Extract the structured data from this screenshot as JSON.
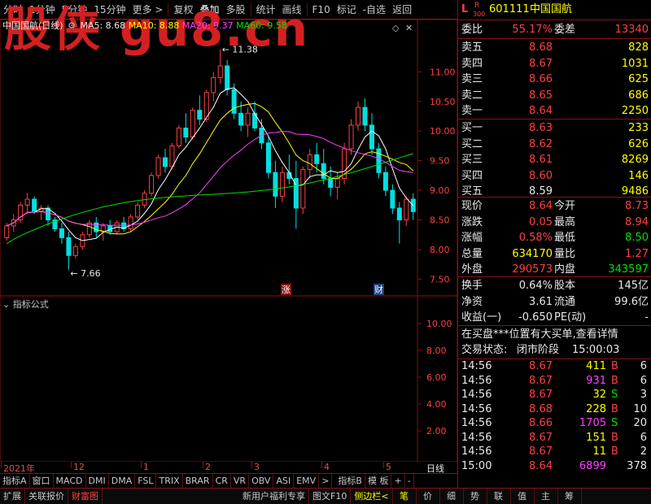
{
  "toolbar": {
    "items": [
      "分时",
      "1分钟",
      "5分钟",
      "15分钟",
      "更多 >",
      "复权",
      "叠加",
      "多股",
      "统计",
      "画线",
      "F10",
      "标记",
      "-自选",
      "返回"
    ]
  },
  "watermark": "股侠 gu8.cn",
  "legend": {
    "name": "中国国航(日线)",
    "ma5": "MA5: 8.68",
    "ma10": "MA10: 8.88",
    "ma20": "MA20: 9.37",
    "ma60": "MA60: 9.58"
  },
  "annotations": {
    "high": "11.38",
    "low": "7.66",
    "zhang": "涨",
    "cai": "财"
  },
  "indicator": {
    "title": "指标公式"
  },
  "colors": {
    "up": "#ff4040",
    "down": "#00e0e0",
    "ma5": "#ffffff",
    "ma10": "#ffff00",
    "ma20": "#ff40ff",
    "ma60": "#00e000",
    "grid": "#8a1010"
  },
  "chart_data": [
    {
      "type": "candlestick",
      "title": "中国国航(日线)",
      "ylim": [
        7.3,
        11.8
      ],
      "yticks": [
        "11.00",
        "10.50",
        "10.00",
        "9.50",
        "9.00",
        "8.50",
        "8.00",
        "7.50"
      ],
      "xticks": [
        "2021年",
        "12",
        "1",
        "2",
        "3",
        "4",
        "5"
      ],
      "series": [
        {
          "name": "MA5",
          "value": 8.68
        },
        {
          "name": "MA10",
          "value": 8.88
        },
        {
          "name": "MA20",
          "value": 9.37
        },
        {
          "name": "MA60",
          "value": 9.58
        }
      ],
      "ohlc": [
        [
          8.2,
          8.45,
          8.15,
          8.4
        ],
        [
          8.4,
          8.6,
          8.3,
          8.5
        ],
        [
          8.5,
          8.8,
          8.45,
          8.75
        ],
        [
          8.75,
          8.95,
          8.6,
          8.85
        ],
        [
          8.85,
          8.9,
          8.6,
          8.65
        ],
        [
          8.65,
          8.75,
          8.5,
          8.7
        ],
        [
          8.7,
          8.75,
          8.4,
          8.5
        ],
        [
          8.5,
          8.55,
          8.3,
          8.35
        ],
        [
          8.35,
          8.45,
          8.1,
          8.2
        ],
        [
          8.2,
          8.3,
          7.66,
          7.9
        ],
        [
          7.9,
          8.1,
          7.85,
          8.05
        ],
        [
          8.05,
          8.3,
          8.0,
          8.25
        ],
        [
          8.25,
          8.5,
          8.2,
          8.45
        ],
        [
          8.45,
          8.55,
          8.2,
          8.3
        ],
        [
          8.3,
          8.45,
          8.15,
          8.4
        ],
        [
          8.4,
          8.5,
          8.25,
          8.3
        ],
        [
          8.3,
          8.5,
          8.25,
          8.45
        ],
        [
          8.45,
          8.55,
          8.3,
          8.35
        ],
        [
          8.35,
          8.6,
          8.3,
          8.55
        ],
        [
          8.55,
          8.8,
          8.5,
          8.75
        ],
        [
          8.75,
          9.0,
          8.7,
          8.95
        ],
        [
          8.95,
          9.3,
          8.9,
          9.25
        ],
        [
          9.25,
          9.6,
          9.2,
          9.55
        ],
        [
          9.55,
          9.7,
          9.3,
          9.4
        ],
        [
          9.4,
          9.8,
          9.35,
          9.75
        ],
        [
          9.75,
          10.1,
          9.7,
          10.05
        ],
        [
          10.05,
          10.3,
          9.8,
          9.9
        ],
        [
          9.9,
          10.4,
          9.85,
          10.35
        ],
        [
          10.35,
          10.6,
          10.1,
          10.2
        ],
        [
          10.2,
          10.7,
          10.15,
          10.65
        ],
        [
          10.65,
          11.0,
          10.5,
          10.9
        ],
        [
          10.9,
          11.38,
          10.8,
          11.1
        ],
        [
          11.1,
          11.2,
          10.6,
          10.7
        ],
        [
          10.7,
          10.8,
          10.2,
          10.3
        ],
        [
          10.3,
          10.5,
          10.0,
          10.1
        ],
        [
          10.1,
          10.4,
          9.9,
          10.3
        ],
        [
          10.3,
          10.5,
          10.0,
          10.05
        ],
        [
          10.05,
          10.2,
          9.7,
          9.8
        ],
        [
          9.8,
          9.9,
          9.2,
          9.3
        ],
        [
          9.3,
          9.5,
          8.7,
          8.9
        ],
        [
          8.9,
          9.4,
          8.8,
          9.3
        ],
        [
          9.3,
          9.6,
          9.1,
          9.2
        ],
        [
          9.2,
          9.5,
          8.35,
          8.7
        ],
        [
          8.7,
          9.4,
          8.6,
          9.35
        ],
        [
          9.35,
          9.7,
          9.2,
          9.6
        ],
        [
          9.6,
          9.8,
          9.3,
          9.45
        ],
        [
          9.45,
          9.7,
          9.1,
          9.2
        ],
        [
          9.2,
          9.4,
          8.9,
          9.05
        ],
        [
          9.05,
          9.3,
          8.85,
          9.2
        ],
        [
          9.2,
          9.8,
          9.1,
          9.7
        ],
        [
          9.7,
          10.2,
          9.6,
          10.1
        ],
        [
          10.1,
          10.5,
          10.0,
          10.4
        ],
        [
          10.4,
          10.55,
          10.0,
          10.1
        ],
        [
          10.1,
          10.3,
          9.6,
          9.7
        ],
        [
          9.7,
          9.8,
          9.2,
          9.3
        ],
        [
          9.3,
          9.4,
          8.9,
          9.0
        ],
        [
          9.0,
          9.1,
          8.6,
          8.7
        ],
        [
          8.7,
          8.8,
          8.1,
          8.5
        ],
        [
          8.5,
          8.9,
          8.4,
          8.85
        ],
        [
          8.85,
          8.95,
          8.5,
          8.64
        ]
      ]
    },
    {
      "type": "line",
      "title": "指标公式",
      "yticks": [
        "10.00",
        "8.00",
        "6.00",
        "4.00",
        "2.00"
      ]
    }
  ],
  "timeaxis": [
    "2021年",
    "12",
    "1",
    "2",
    "3",
    "4",
    "5"
  ],
  "period": "日线",
  "indicatorTabs": [
    "指标A",
    "窗口",
    "MACD",
    "DMI",
    "DMA",
    "FSL",
    "TRIX",
    "BRAR",
    "CR",
    "VR",
    "OBV",
    "ASI",
    "EMV",
    ">",
    "指标B",
    "模 板",
    "+",
    "-"
  ],
  "bottomTabs": [
    "扩展",
    "关联报价",
    "财富图",
    "新用户福利专享",
    "图文F10",
    "侧边栏<"
  ],
  "rightTabs": [
    "笔",
    "价",
    "细",
    "势",
    "联",
    "值",
    "主",
    "筹"
  ],
  "quote": {
    "prefix": "L",
    "rsup": "R",
    "rsub": "300",
    "code": "601111",
    "name": "中国国航",
    "weibi_label": "委比",
    "weibi": "55.17%",
    "weicha_label": "委差",
    "weicha": "13340",
    "asks": [
      {
        "label": "卖五",
        "price": "8.68",
        "vol": "828"
      },
      {
        "label": "卖四",
        "price": "8.67",
        "vol": "1031"
      },
      {
        "label": "卖三",
        "price": "8.66",
        "vol": "625"
      },
      {
        "label": "卖二",
        "price": "8.65",
        "vol": "686"
      },
      {
        "label": "卖一",
        "price": "8.64",
        "vol": "2250"
      }
    ],
    "bids": [
      {
        "label": "买一",
        "price": "8.63",
        "vol": "233"
      },
      {
        "label": "买二",
        "price": "8.62",
        "vol": "626"
      },
      {
        "label": "买三",
        "price": "8.61",
        "vol": "8269"
      },
      {
        "label": "买四",
        "price": "8.60",
        "vol": "146"
      },
      {
        "label": "买五",
        "price": "8.59",
        "vol": "9486"
      }
    ],
    "stats": [
      {
        "l1": "现价",
        "v1": "8.64",
        "c1": "r",
        "l2": "今开",
        "v2": "8.73",
        "c2": "r"
      },
      {
        "l1": "涨跌",
        "v1": "0.05",
        "c1": "r",
        "l2": "最高",
        "v2": "8.94",
        "c2": "r"
      },
      {
        "l1": "涨幅",
        "v1": "0.58%",
        "c1": "r",
        "l2": "最低",
        "v2": "8.50",
        "c2": "g"
      },
      {
        "l1": "总量",
        "v1": "634170",
        "c1": "y",
        "l2": "量比",
        "v2": "1.27",
        "c2": "r"
      },
      {
        "l1": "外盘",
        "v1": "290573",
        "c1": "r",
        "l2": "内盘",
        "v2": "343597",
        "c2": "g"
      }
    ],
    "fin": [
      {
        "l1": "换手",
        "v1": "0.64%",
        "l2": "股本",
        "v2": "145亿"
      },
      {
        "l1": "净资",
        "v1": "3.61",
        "l2": "流通",
        "v2": "99.6亿"
      },
      {
        "l1": "收益(一)",
        "v1": "-0.650",
        "l2": "PE(动)",
        "v2": "-"
      }
    ],
    "notice": "在买盘***位置有大买单,查看详情",
    "status_label": "交易状态:",
    "status": "闭市阶段",
    "status_time": "15:00:03",
    "ticks": [
      {
        "t": "14:56",
        "p": "8.67",
        "v": "411",
        "d": "B",
        "n": "6",
        "vc": "y",
        "dc": "r"
      },
      {
        "t": "14:56",
        "p": "8.67",
        "v": "931",
        "d": "B",
        "n": "6",
        "vc": "m",
        "dc": "r"
      },
      {
        "t": "14:56",
        "p": "8.67",
        "v": "32",
        "d": "S",
        "n": "3",
        "vc": "y",
        "dc": "g"
      },
      {
        "t": "14:56",
        "p": "8.68",
        "v": "228",
        "d": "B",
        "n": "10",
        "vc": "y",
        "dc": "r"
      },
      {
        "t": "14:56",
        "p": "8.66",
        "v": "1705",
        "d": "S",
        "n": "20",
        "vc": "m",
        "dc": "g"
      },
      {
        "t": "14:56",
        "p": "8.67",
        "v": "151",
        "d": "B",
        "n": "6",
        "vc": "y",
        "dc": "r"
      },
      {
        "t": "14:56",
        "p": "8.67",
        "v": "11",
        "d": "B",
        "n": "2",
        "vc": "y",
        "dc": "r"
      },
      {
        "t": "15:00",
        "p": "8.64",
        "v": "6899",
        "d": "",
        "n": "378",
        "vc": "m",
        "dc": "r"
      }
    ]
  }
}
